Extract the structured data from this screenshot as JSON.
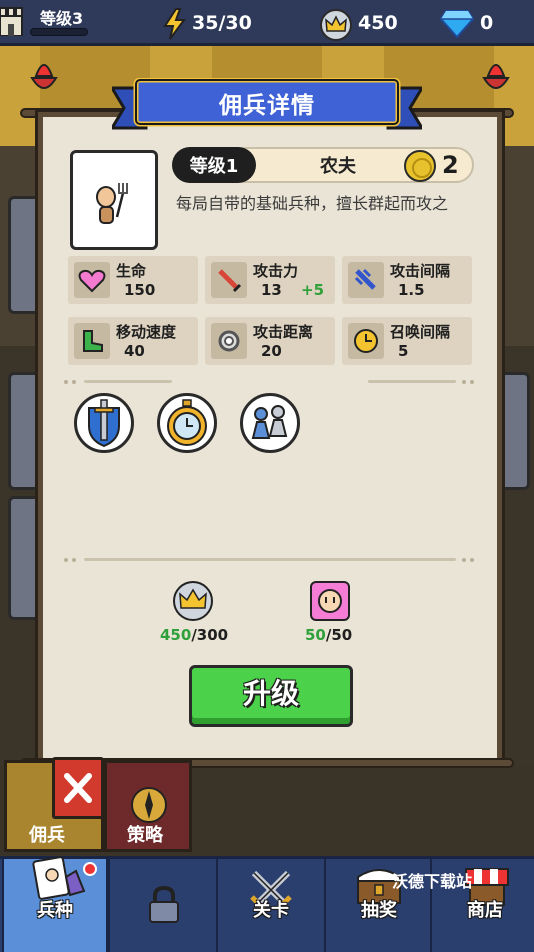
{
  "topbar": {
    "level_label": "等级3",
    "energy": "35/30",
    "crowns": "450",
    "gems": "0"
  },
  "dialog": {
    "title": "佣兵详情",
    "level": "等级1",
    "unit_name": "农夫",
    "cost": "2",
    "description": "每局自带的基础兵种，擅长群起而攻之",
    "stats": [
      {
        "label": "生命",
        "value": "150",
        "bonus": "",
        "icon": "heart-icon"
      },
      {
        "label": "攻击力",
        "value": "13",
        "bonus": "+5",
        "icon": "sword-icon"
      },
      {
        "label": "攻击间隔",
        "value": "1.5",
        "bonus": "",
        "icon": "blue-sword-icon"
      },
      {
        "label": "移动速度",
        "value": "40",
        "bonus": "",
        "icon": "boot-icon"
      },
      {
        "label": "攻击距离",
        "value": "20",
        "bonus": "",
        "icon": "range-icon"
      },
      {
        "label": "召唤间隔",
        "value": "5",
        "bonus": "",
        "icon": "clock-icon"
      }
    ],
    "skills": [
      "shield-sword-icon",
      "stopwatch-icon",
      "pawn-group-icon"
    ],
    "resources": [
      {
        "have": "450",
        "need": "/300",
        "icon": "crown-icon"
      },
      {
        "have": "50",
        "need": "/50",
        "icon": "peasant-token-icon"
      }
    ],
    "upgrade_label": "升级"
  },
  "subtabs": [
    {
      "label": "佣兵"
    },
    {
      "label": "策略"
    }
  ],
  "nav": [
    {
      "label": "兵种",
      "active": true
    },
    {
      "label": "",
      "locked": true
    },
    {
      "label": "关卡"
    },
    {
      "label": "抽奖"
    },
    {
      "label": "商店"
    }
  ],
  "watermark": "沃德下载站",
  "colors": {
    "accent_blue": "#2e4fb8",
    "upgrade_green": "#4bd14a",
    "bonus_green": "#2fa03a",
    "close_red": "#d33a2e"
  }
}
